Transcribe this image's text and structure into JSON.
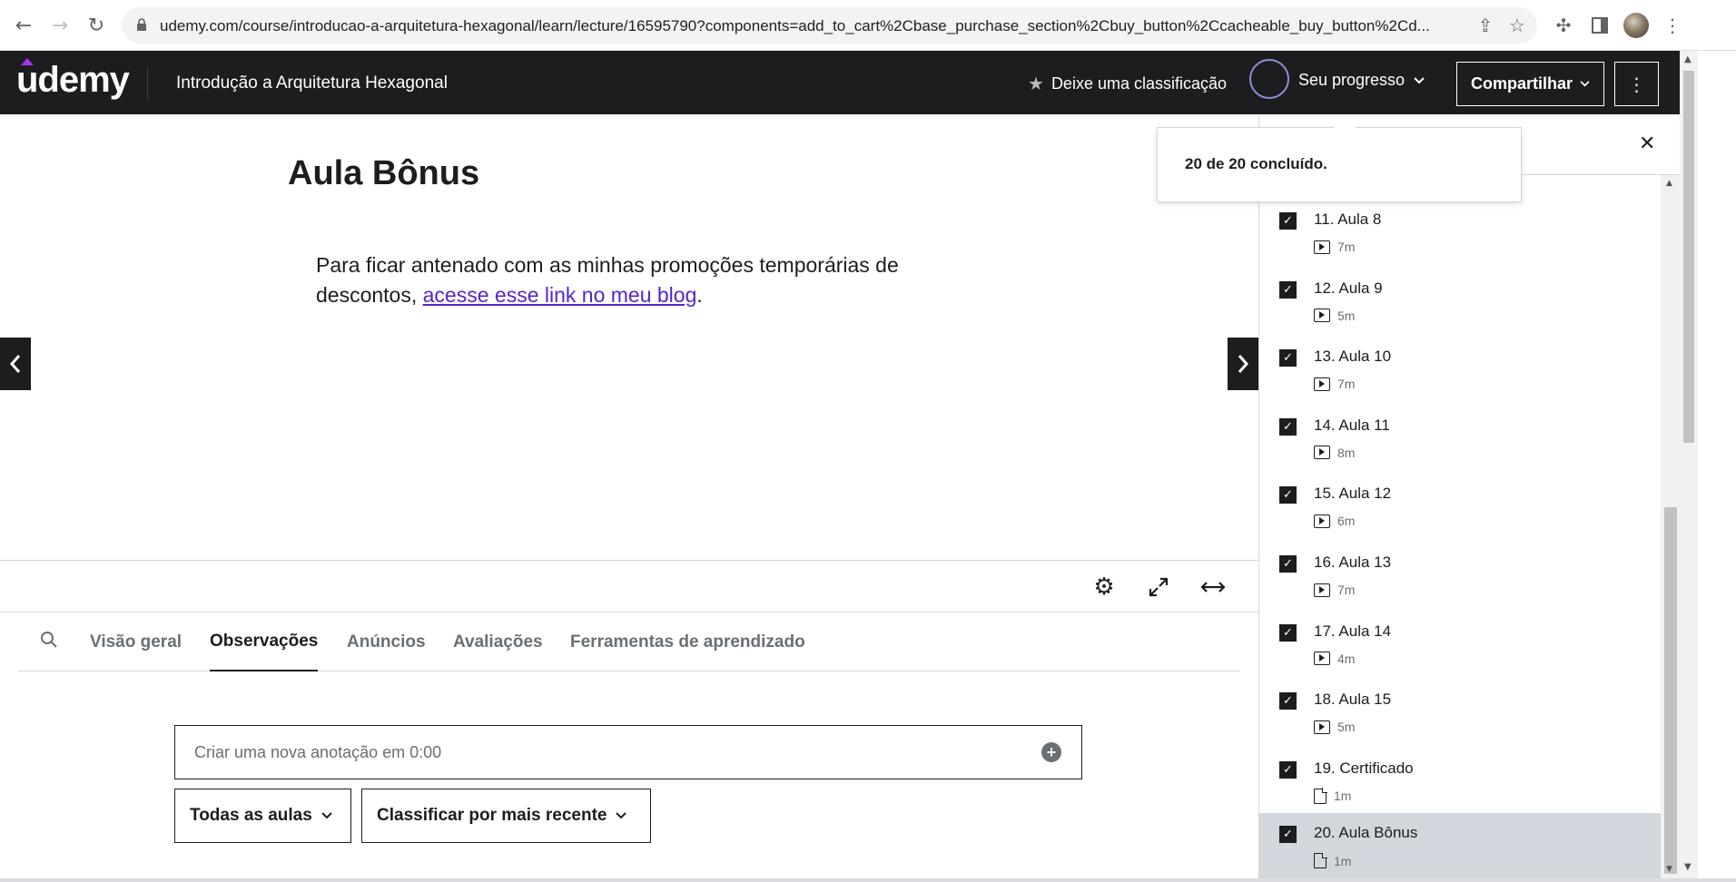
{
  "browser": {
    "url": "udemy.com/course/introducao-a-arquitetura-hexagonal/learn/lecture/16595790?components=add_to_cart%2Cbase_purchase_section%2Cbuy_button%2Ccacheable_buy_button%2Cd..."
  },
  "header": {
    "logo": "udemy",
    "course_title": "Introdução a Arquitetura Hexagonal",
    "rate_label": "Deixe uma classificação",
    "progress_label": "Seu progresso",
    "share_label": "Compartilhar"
  },
  "progress_popover": {
    "text": "20 de 20 concluído."
  },
  "lecture": {
    "title": "Aula Bônus",
    "text_before": "Para ficar antenado com as minhas promoções temporárias de descontos, ",
    "link_text": "acesse esse link no meu blog",
    "text_after": "."
  },
  "tabs": [
    {
      "label": "Visão geral"
    },
    {
      "label": "Observações"
    },
    {
      "label": "Anúncios"
    },
    {
      "label": "Avaliações"
    },
    {
      "label": "Ferramentas de aprendizado"
    }
  ],
  "active_tab": "Observações",
  "notes": {
    "placeholder": "Criar uma nova anotação em 0:00",
    "filter_lectures": "Todas as aulas",
    "sort": "Classificar por mais recente"
  },
  "sidebar": {
    "lessons": [
      {
        "title": "11. Aula 8",
        "duration": "7m",
        "kind": "video"
      },
      {
        "title": "12. Aula 9",
        "duration": "5m",
        "kind": "video"
      },
      {
        "title": "13. Aula 10",
        "duration": "7m",
        "kind": "video"
      },
      {
        "title": "14. Aula 11",
        "duration": "8m",
        "kind": "video"
      },
      {
        "title": "15. Aula 12",
        "duration": "6m",
        "kind": "video"
      },
      {
        "title": "16. Aula 13",
        "duration": "7m",
        "kind": "video"
      },
      {
        "title": "17. Aula 14",
        "duration": "4m",
        "kind": "video"
      },
      {
        "title": "18. Aula 15",
        "duration": "5m",
        "kind": "video"
      },
      {
        "title": "19. Certificado",
        "duration": "1m",
        "kind": "document"
      },
      {
        "title": "20. Aula Bônus",
        "duration": "1m",
        "kind": "document"
      }
    ]
  },
  "colors": {
    "header_bg": "#1c1d1f",
    "link": "#5624d0",
    "brand_accent": "#a435f0",
    "current_lesson_bg": "#d1d7dc"
  }
}
